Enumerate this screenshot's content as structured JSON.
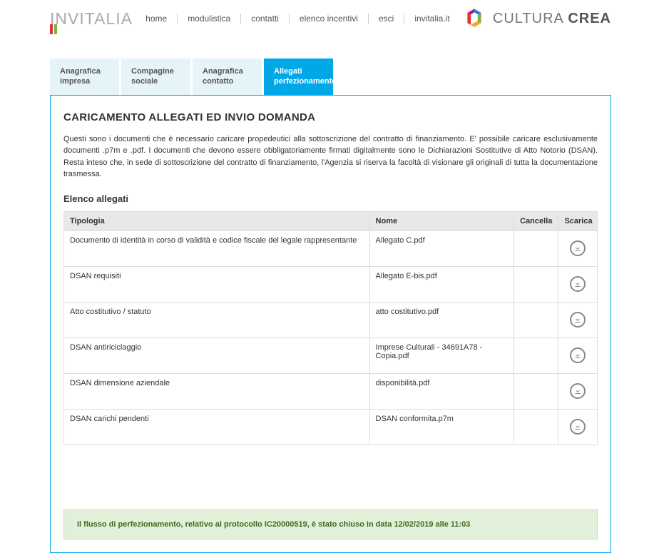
{
  "header": {
    "logo_left": "INVITALIA",
    "nav": [
      "home",
      "modulistica",
      "contatti",
      "elenco incentivi",
      "esci",
      "invitalia.it"
    ],
    "logo_right_part1": "CULTURA ",
    "logo_right_part2": "CREA"
  },
  "tabs": [
    {
      "label": "Anagrafica impresa",
      "active": false
    },
    {
      "label": "Compagine sociale",
      "active": false
    },
    {
      "label": "Anagrafica contatto",
      "active": false
    },
    {
      "label": "Allegati perfezionamento",
      "active": true
    }
  ],
  "main": {
    "title": "CARICAMENTO ALLEGATI ED INVIO DOMANDA",
    "description": "Questi sono i documenti che è necessario caricare propedeutici alla sottoscrizione del contratto di finanziamento. E' possibile caricare esclusivamente documenti .p7m e .pdf. I documenti che devono essere obbligatoriamente firmati digitalmente sono le Dichiarazioni Sostitutive di Atto Notorio (DSAN). Resta inteso che, in sede di sottoscrizione del contratto di finanziamento, l'Agenzia si riserva la facoltà di visionare gli originali di tutta la documentazione trasmessa.",
    "list_heading": "Elenco allegati",
    "columns": {
      "tipologia": "Tipologia",
      "nome": "Nome",
      "cancella": "Cancella",
      "scarica": "Scarica"
    },
    "rows": [
      {
        "tipologia": "Documento di identità in corso di validità e codice fiscale del legale rappresentante",
        "nome": "Allegato C.pdf"
      },
      {
        "tipologia": "DSAN requisiti",
        "nome": "Allegato E-bis.pdf"
      },
      {
        "tipologia": "Atto costitutivo / statuto",
        "nome": "atto costitutivo.pdf"
      },
      {
        "tipologia": "DSAN antiriciclaggio",
        "nome": "Imprese Culturali - 34691A78 - Copia.pdf"
      },
      {
        "tipologia": "DSAN dimensione aziendale",
        "nome": "disponibilità.pdf"
      },
      {
        "tipologia": "DSAN carichi pendenti",
        "nome": "DSAN conformita.p7m"
      }
    ],
    "status_message": "Il flusso di perfezionamento, relativo al protocollo IC20000519, è stato chiuso in data 12/02/2019 alle 11:03"
  }
}
